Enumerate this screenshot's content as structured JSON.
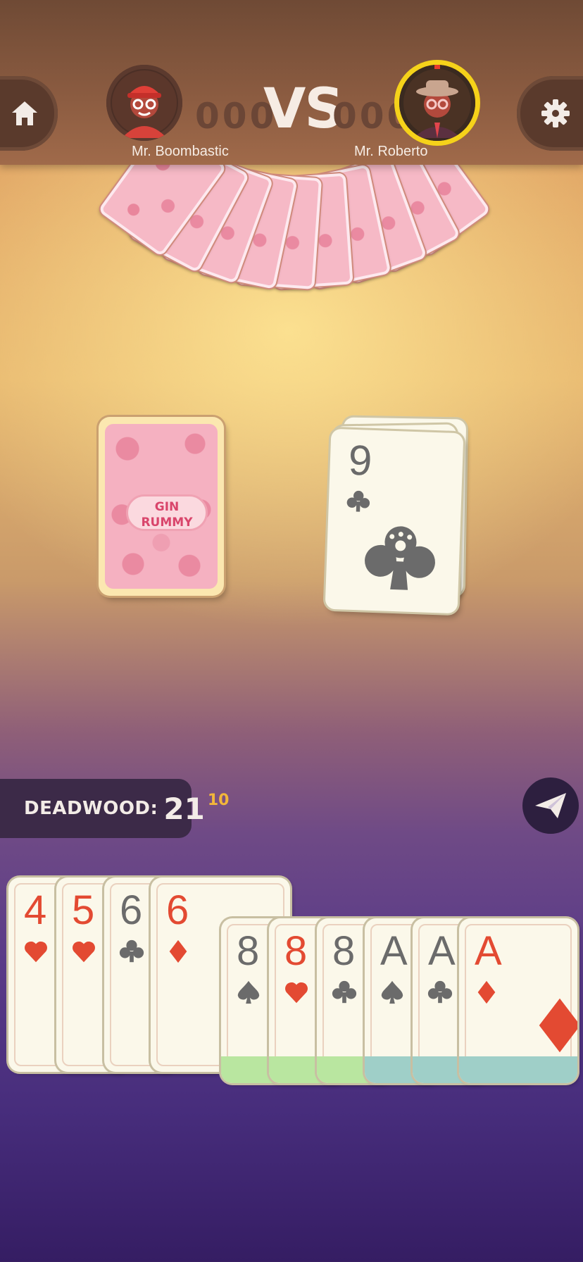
{
  "header": {
    "player1": {
      "name": "Mr. Boombastic",
      "score": "000"
    },
    "vs": "VS",
    "player2": {
      "name": "Mr. Roberto",
      "score": "000"
    },
    "home_icon": "home-icon",
    "settings_icon": "gear-icon",
    "active_ring_color": "#f5d21a"
  },
  "table": {
    "stock_back_text": [
      "GIN",
      "RUMMY"
    ],
    "discard_top": {
      "rank": "9",
      "suit": "clubs"
    }
  },
  "deadwood": {
    "label": "DEADWOOD:",
    "value": "21",
    "extra": "10"
  },
  "send_icon": "paper-plane-icon",
  "hand": [
    {
      "rank": "4",
      "suit": "hearts",
      "meld": null
    },
    {
      "rank": "5",
      "suit": "hearts",
      "meld": null
    },
    {
      "rank": "6",
      "suit": "clubs",
      "meld": null
    },
    {
      "rank": "6",
      "suit": "diamonds",
      "meld": null
    },
    {
      "rank": "8",
      "suit": "spades",
      "meld": "#b9e6a0"
    },
    {
      "rank": "8",
      "suit": "hearts",
      "meld": "#b9e6a0"
    },
    {
      "rank": "8",
      "suit": "clubs",
      "meld": "#b9e6a0"
    },
    {
      "rank": "A",
      "suit": "spades",
      "meld": "#9fcfc8"
    },
    {
      "rank": "A",
      "suit": "clubs",
      "meld": "#9fcfc8"
    },
    {
      "rank": "A",
      "suit": "diamonds",
      "meld": "#9fcfc8"
    }
  ],
  "colors": {
    "red_suit": "#e34a32",
    "black_suit": "#6b6b6b",
    "card_back": "#f5b1c1"
  }
}
